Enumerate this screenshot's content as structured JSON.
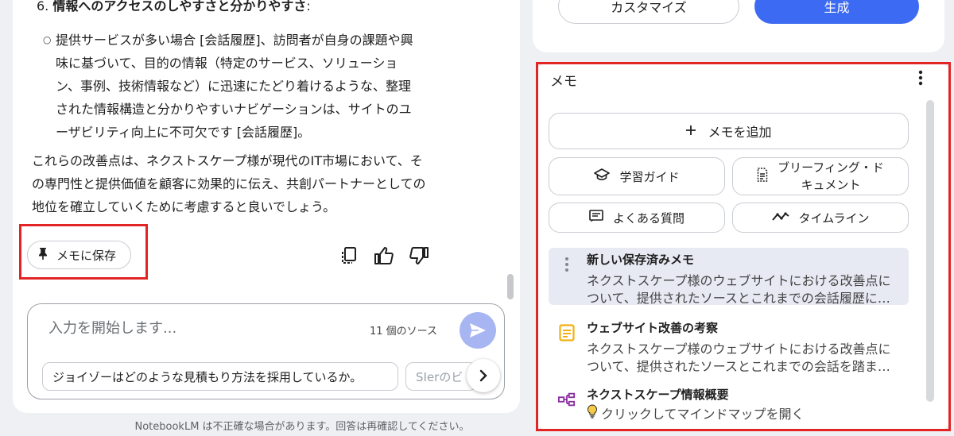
{
  "chat": {
    "heading": "6. ",
    "heading_bold": "情報へのアクセスのしやすさと分かりやすさ",
    "heading_colon": ":",
    "bullet_lines": [
      "提供サービスが多い場合 [会話履歴]、訪問者が自身の課題や興",
      "味に基づいて、目的の情報（特定のサービス、ソリューショ",
      "ン、事例、技術情報など）に迅速にたどり着けるような、整理",
      "された情報構造と分かりやすいナビゲーションは、サイトのユ",
      "ーザビリティ向上に不可欠です [会話履歴]。"
    ],
    "para_lines": [
      "これらの改善点は、ネクストスケープ様が現代のIT市場において、そ",
      "の専門性と提供価値を顧客に効果的に伝え、共創パートナーとしての",
      "地位を確立していくために考慮すると良いでしょう。"
    ],
    "save_note_label": "メモに保存"
  },
  "composer": {
    "placeholder": "入力を開始します...",
    "source_count": "11 個のソース",
    "suggestions": [
      "ジョイゾーはどのような見積もり方法を採用しているか。",
      "SIerのビ"
    ]
  },
  "disclaimer": "NotebookLM は不正確な場合があります。回答は再確認してください。",
  "studio": {
    "customize_label": "カスタマイズ",
    "generate_label": "生成"
  },
  "memo": {
    "title": "メモ",
    "add_label": "メモを追加",
    "tools": {
      "study": "学習ガイド",
      "brief_line1": "ブリーフィング・ド",
      "brief_line2": "キュメント",
      "faq": "よくある質問",
      "timeline": "タイムライン"
    },
    "notes": [
      {
        "title": "新しい保存済みメモ",
        "line1": "ネクストスケープ様のウェブサイトにおける改善点に",
        "line2": "ついて、提供されたソースとこれまでの会話履歴に…"
      },
      {
        "title": "ウェブサイト改善の考察",
        "line1": "ネクストスケープ様のウェブサイトにおける改善点に",
        "line2": "ついて、提供されたソースとこれまでの会話を踏ま…"
      },
      {
        "title": "ネクストスケープ情報概要",
        "line1": "クリックしてマインドマップを開く"
      }
    ]
  },
  "colors": {
    "accent_blue": "#3d6af2",
    "send_button": "#a8b5f3",
    "highlight_red": "#e32424",
    "note_icon_yellow": "#f2b10f",
    "mindmap_icon_purple": "#8a2ea0"
  }
}
